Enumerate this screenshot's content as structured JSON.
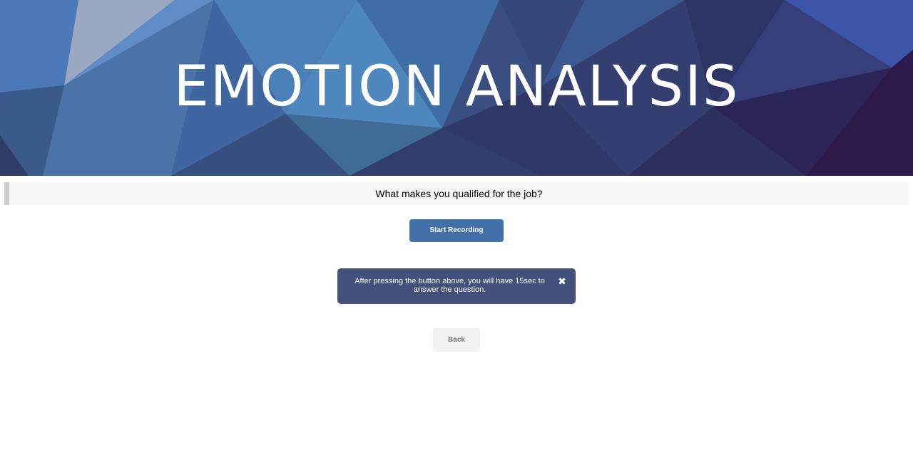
{
  "header": {
    "title": "EMOTION ANALYSIS"
  },
  "question": {
    "text": "What makes you qualified for the job?"
  },
  "actions": {
    "record_label": "Start Recording",
    "back_label": "Back"
  },
  "notice": {
    "text": "After pressing the button above, you will have 15sec to answer the question.",
    "close_glyph": "✖"
  },
  "colors": {
    "record_button": "#4271a8",
    "notice_background": "#42507a",
    "header_background": "#35406e"
  },
  "icons": {
    "notice_close": "close-icon"
  }
}
